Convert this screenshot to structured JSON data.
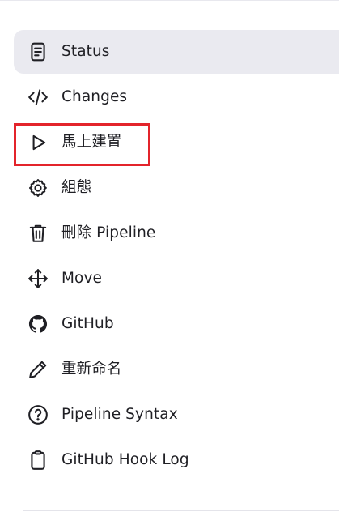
{
  "highlight_color": "#e3242b",
  "active_bg": "#eaeaf0",
  "tasks": [
    {
      "label": "Status",
      "icon": "document-icon",
      "active": true
    },
    {
      "label": "Changes",
      "icon": "code-icon"
    },
    {
      "label": "馬上建置",
      "icon": "play-icon",
      "highlighted": true
    },
    {
      "label": "組態",
      "icon": "gear-icon"
    },
    {
      "label": "刪除 Pipeline",
      "icon": "trash-icon"
    },
    {
      "label": "Move",
      "icon": "move-icon"
    },
    {
      "label": "GitHub",
      "icon": "github-icon"
    },
    {
      "label": "重新命名",
      "icon": "pencil-icon"
    },
    {
      "label": "Pipeline Syntax",
      "icon": "help-icon"
    },
    {
      "label": "GitHub Hook Log",
      "icon": "clipboard-icon"
    }
  ]
}
